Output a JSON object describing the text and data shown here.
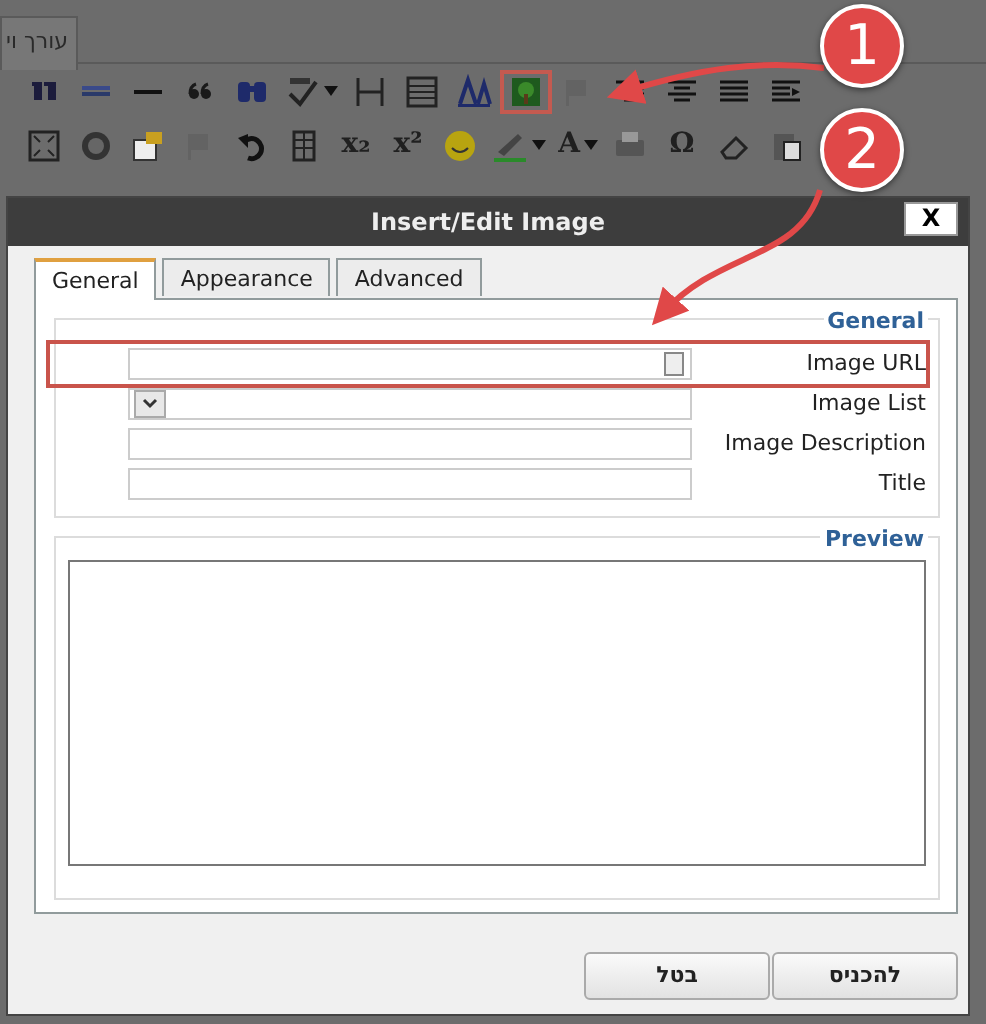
{
  "editor": {
    "tab": "עורך וי",
    "toolbar_rows": [
      [
        {
          "kind": "icon",
          "disabled": false
        },
        {
          "kind": "icon",
          "disabled": false
        },
        {
          "kind": "icon",
          "disabled": false
        },
        {
          "kind": "icon",
          "disabled": false
        },
        {
          "kind": "icon",
          "disabled": false
        },
        {
          "kind": "icon",
          "disabled": false,
          "dropdown": true
        },
        {
          "kind": "icon",
          "disabled": false
        },
        {
          "kind": "icon",
          "disabled": false
        },
        {
          "kind": "icon",
          "disabled": false
        },
        {
          "kind": "icon",
          "disabled": false,
          "highlighted": true
        },
        {
          "kind": "icon",
          "disabled": true
        },
        {
          "kind": "icon",
          "disabled": false
        },
        {
          "kind": "icon",
          "disabled": false
        },
        {
          "kind": "icon",
          "disabled": false
        },
        {
          "kind": "icon",
          "disabled": false
        }
      ],
      [
        {
          "kind": "icon",
          "disabled": false
        },
        {
          "kind": "icon",
          "disabled": false
        },
        {
          "kind": "icon",
          "disabled": false
        },
        {
          "kind": "icon",
          "disabled": true
        },
        {
          "kind": "icon",
          "disabled": false
        },
        {
          "kind": "icon",
          "disabled": false
        },
        {
          "kind": "glyph",
          "text": "x₂",
          "disabled": false
        },
        {
          "kind": "glyph",
          "text": "x²",
          "disabled": false
        },
        {
          "kind": "icon",
          "disabled": false
        },
        {
          "kind": "icon",
          "disabled": false,
          "dropdown": true
        },
        {
          "kind": "glyph",
          "text": "A",
          "disabled": false,
          "dropdown": true
        },
        {
          "kind": "icon",
          "disabled": false
        },
        {
          "kind": "glyph",
          "text": "Ω",
          "disabled": false
        },
        {
          "kind": "icon",
          "disabled": false
        },
        {
          "kind": "icon",
          "disabled": false
        }
      ]
    ]
  },
  "callouts": [
    {
      "text": "1"
    },
    {
      "text": "2"
    }
  ],
  "dialog": {
    "title": "Insert/Edit Image",
    "close": "X",
    "tabs": [
      {
        "label": "General",
        "selected": true
      },
      {
        "label": "Appearance",
        "selected": false
      },
      {
        "label": "Advanced",
        "selected": false
      }
    ],
    "general": {
      "legend": "General",
      "fields": [
        {
          "label": "Image URL",
          "kind": "url",
          "highlighted": true
        },
        {
          "label": "Image List",
          "kind": "select"
        },
        {
          "label": "Image Description",
          "kind": "text"
        },
        {
          "label": "Title",
          "kind": "text"
        }
      ]
    },
    "preview": {
      "legend": "Preview"
    },
    "buttons": [
      {
        "label": "להכניס"
      },
      {
        "label": "בטל"
      }
    ]
  }
}
